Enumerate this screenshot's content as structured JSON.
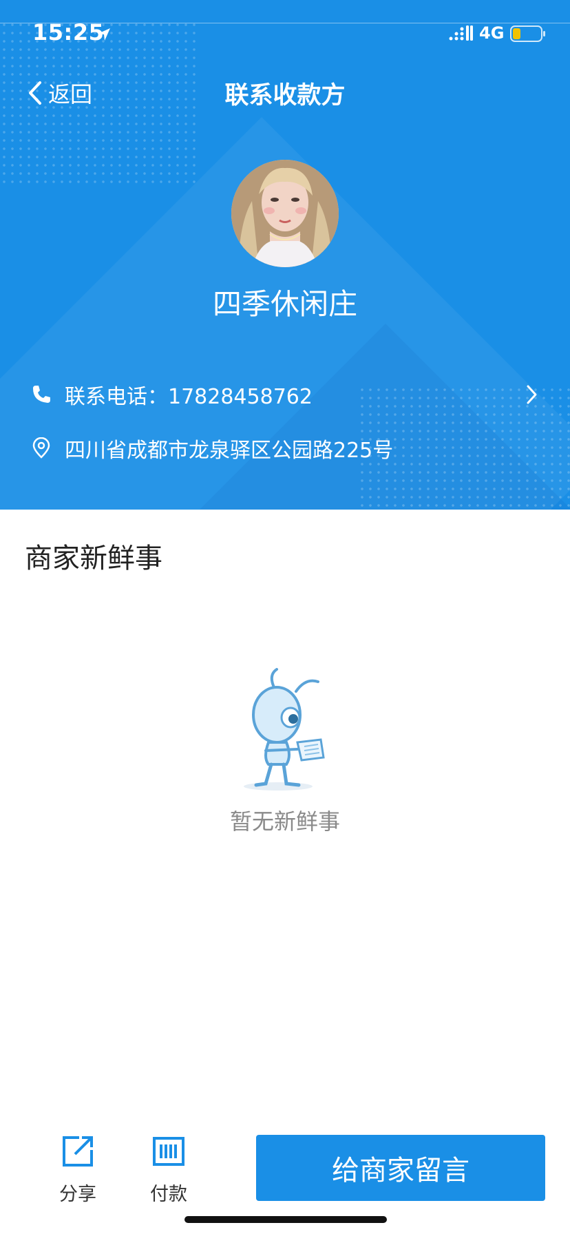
{
  "status_bar": {
    "time": "15:25",
    "network": "4G"
  },
  "nav": {
    "back_label": "返回",
    "title": "联系收款方"
  },
  "merchant": {
    "name": "四季休闲庄",
    "phone_text": "联系电话：17828458762",
    "address": "四川省成都市龙泉驿区公园路225号"
  },
  "news": {
    "title": "商家新鲜事",
    "empty_text": "暂无新鲜事"
  },
  "bottom_bar": {
    "share_label": "分享",
    "pay_label": "付款",
    "message_button": "给商家留言"
  },
  "colors": {
    "primary": "#1a8fe6",
    "battery_fill": "#f2c200"
  },
  "icons": [
    "location-arrow-icon",
    "signal-icon",
    "battery-icon",
    "back-chevron-icon",
    "phone-icon",
    "map-pin-icon",
    "chevron-right-icon",
    "share-icon",
    "barcode-pay-icon",
    "ant-reading-illustration"
  ]
}
